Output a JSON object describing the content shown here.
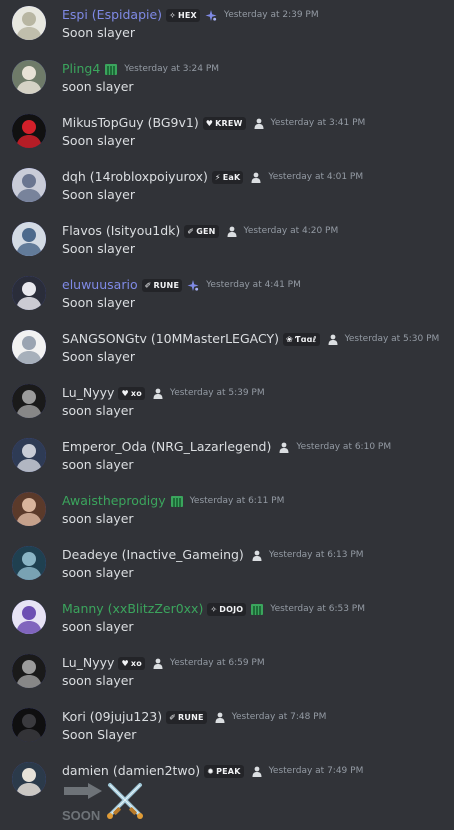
{
  "messages": [
    {
      "name": "Espi (Espidapie)",
      "name_color": "#7f8ae6",
      "tag": "HEX",
      "tag_glyph": "✧",
      "extra": "sparkle-icon",
      "time": "Yesterday at 2:39 PM",
      "text": "Soon slayer",
      "avatar_bg": "#e8e8e0",
      "avatar_fg": "#b8b6a2"
    },
    {
      "name": "Pling4",
      "name_color": "#3ba55d",
      "tag": "",
      "extra": "green-role-icon",
      "time": "Yesterday at 3:24 PM",
      "text": "soon slayer",
      "avatar_bg": "#6f7b69",
      "avatar_fg": "#e8e2d6"
    },
    {
      "name": "MikusTopGuy (BG9v1)",
      "name_color": "#dbdee1",
      "tag": "KREW",
      "tag_glyph": "♥",
      "extra": "person-icon",
      "time": "Yesterday at 3:41 PM",
      "text": "Soon slayer",
      "avatar_bg": "#111111",
      "avatar_fg": "#d3202a"
    },
    {
      "name": "dqh (14robloxpoiyurox)",
      "name_color": "#dbdee1",
      "tag": "EaK",
      "tag_glyph": "⚡",
      "extra": "person-icon",
      "time": "Yesterday at 4:01 PM",
      "text": "Soon slayer",
      "avatar_bg": "#c9ccd8",
      "avatar_fg": "#6a7590"
    },
    {
      "name": "Flavos (Isityou1dk)",
      "name_color": "#dbdee1",
      "tag": "GEN",
      "tag_glyph": "✐",
      "extra": "person-icon",
      "time": "Yesterday at 4:20 PM",
      "text": "Soon slayer",
      "avatar_bg": "#d4dbe4",
      "avatar_fg": "#4d6a8c"
    },
    {
      "name": "eluwuusario",
      "name_color": "#7f8ae6",
      "tag": "RUNE",
      "tag_glyph": "✐",
      "extra": "sparkle-icon",
      "time": "Yesterday at 4:41 PM",
      "text": "Soon slayer",
      "avatar_bg": "#2a2d3a",
      "avatar_fg": "#e8e8ee"
    },
    {
      "name": "SANGSONGtv (10MMasterLEGACY)",
      "name_color": "#dbdee1",
      "tag": "Ƭɑɑℓ",
      "tag_glyph": "❀",
      "extra": "person-icon",
      "time": "Yesterday at 5:30 PM",
      "text": "Soon slayer",
      "avatar_bg": "#f2f2f2",
      "avatar_fg": "#9aa4b2"
    },
    {
      "name": "Lu_Nyyy",
      "name_color": "#dbdee1",
      "tag": "xo",
      "tag_glyph": "♥",
      "extra": "person-icon",
      "time": "Yesterday at 5:39 PM",
      "text": "soon slayer",
      "avatar_bg": "#1a1a1a",
      "avatar_fg": "#9b9b9b"
    },
    {
      "name": "Emperor_Oda (NRG_Lazarlegend)",
      "name_color": "#dbdee1",
      "tag": "",
      "extra": "person-icon",
      "time": "Yesterday at 6:10 PM",
      "text": "soon slayer",
      "avatar_bg": "#2e3b55",
      "avatar_fg": "#c8ccd6"
    },
    {
      "name": "Awaistheprodigy",
      "name_color": "#3ba55d",
      "tag": "",
      "extra": "green-role-icon",
      "time": "Yesterday at 6:11 PM",
      "text": "soon slayer",
      "avatar_bg": "#5b3a2a",
      "avatar_fg": "#d8b49c"
    },
    {
      "name": "Deadeye (Inactive_Gameing)",
      "name_color": "#dbdee1",
      "tag": "",
      "extra": "person-icon",
      "time": "Yesterday at 6:13 PM",
      "text": "soon slayer",
      "avatar_bg": "#1f4050",
      "avatar_fg": "#8ab4c4"
    },
    {
      "name": "Manny (xxBlitzZer0xx)",
      "name_color": "#3ba55d",
      "tag": "DOJO",
      "tag_glyph": "✧",
      "extra": "green-role-icon",
      "time": "Yesterday at 6:53 PM",
      "text": "soon slayer",
      "avatar_bg": "#e7e3f5",
      "avatar_fg": "#6d4fb3"
    },
    {
      "name": "Lu_Nyyy",
      "name_color": "#dbdee1",
      "tag": "xo",
      "tag_glyph": "♥",
      "extra": "person-icon",
      "time": "Yesterday at 6:59 PM",
      "text": "soon slayer",
      "avatar_bg": "#1a1a1a",
      "avatar_fg": "#9b9b9b"
    },
    {
      "name": "Kori (09juju123)",
      "name_color": "#dbdee1",
      "tag": "RUNE",
      "tag_glyph": "✐",
      "extra": "person-icon",
      "time": "Yesterday at 7:48 PM",
      "text": "Soon Slayer",
      "avatar_bg": "#0f0f10",
      "avatar_fg": "#3a3a3e"
    },
    {
      "name": "damien (damien2two)",
      "name_color": "#dbdee1",
      "tag": "PEAK",
      "tag_glyph": "✹",
      "extra": "person-icon",
      "time": "Yesterday at 7:49 PM",
      "text": "",
      "avatar_bg": "#2b3a4a",
      "avatar_fg": "#e6e1d8"
    }
  ],
  "soon_emote": {
    "label": "SOON"
  },
  "colors": {
    "background": "#313338",
    "timestamp": "#949ba4",
    "green": "#3ba55d",
    "blurple": "#7f8ae6"
  }
}
